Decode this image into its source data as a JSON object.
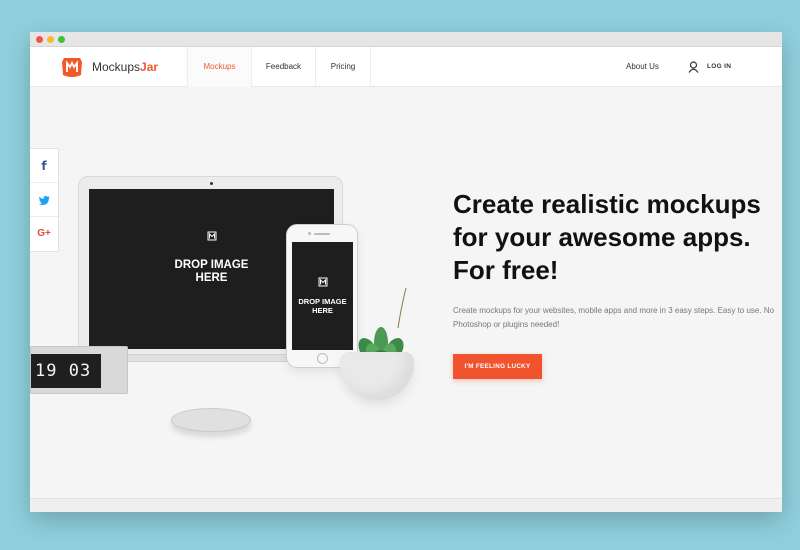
{
  "brand": {
    "name_prefix": "Mockups",
    "name_accent": "Jar"
  },
  "nav": {
    "tabs": [
      {
        "label": "Mockups",
        "active": true
      },
      {
        "label": "Feedback",
        "active": false
      },
      {
        "label": "Pricing",
        "active": false
      }
    ],
    "about_label": "About Us",
    "login_label": "LOG IN"
  },
  "social": [
    {
      "icon": "facebook-icon",
      "glyph": "f"
    },
    {
      "icon": "twitter-icon",
      "glyph": "▶"
    },
    {
      "icon": "google-plus-icon",
      "glyph": "G+"
    }
  ],
  "hero": {
    "headline_lines": [
      "Create realistic mockups",
      "for your awesome apps.",
      "For free!"
    ],
    "subtext": "Create mockups for your websites, mobile apps and more in 3 easy steps. Easy to use. No Photoshop or plugins needed!",
    "cta_label": "I'M FEELING LUCKY"
  },
  "laptop_drop": {
    "line1": "DROP IMAGE",
    "line2": "HERE"
  },
  "phone_drop": {
    "line1": "DROP IMAGE",
    "line2": "HERE"
  },
  "clock": {
    "time": "19 03"
  },
  "colors": {
    "accent": "#ee5a2e",
    "cta": "#f0532e",
    "page_bg": "#8fd0dd",
    "facebook": "#3b5998",
    "twitter": "#1da1f2",
    "google": "#dd4b39"
  }
}
